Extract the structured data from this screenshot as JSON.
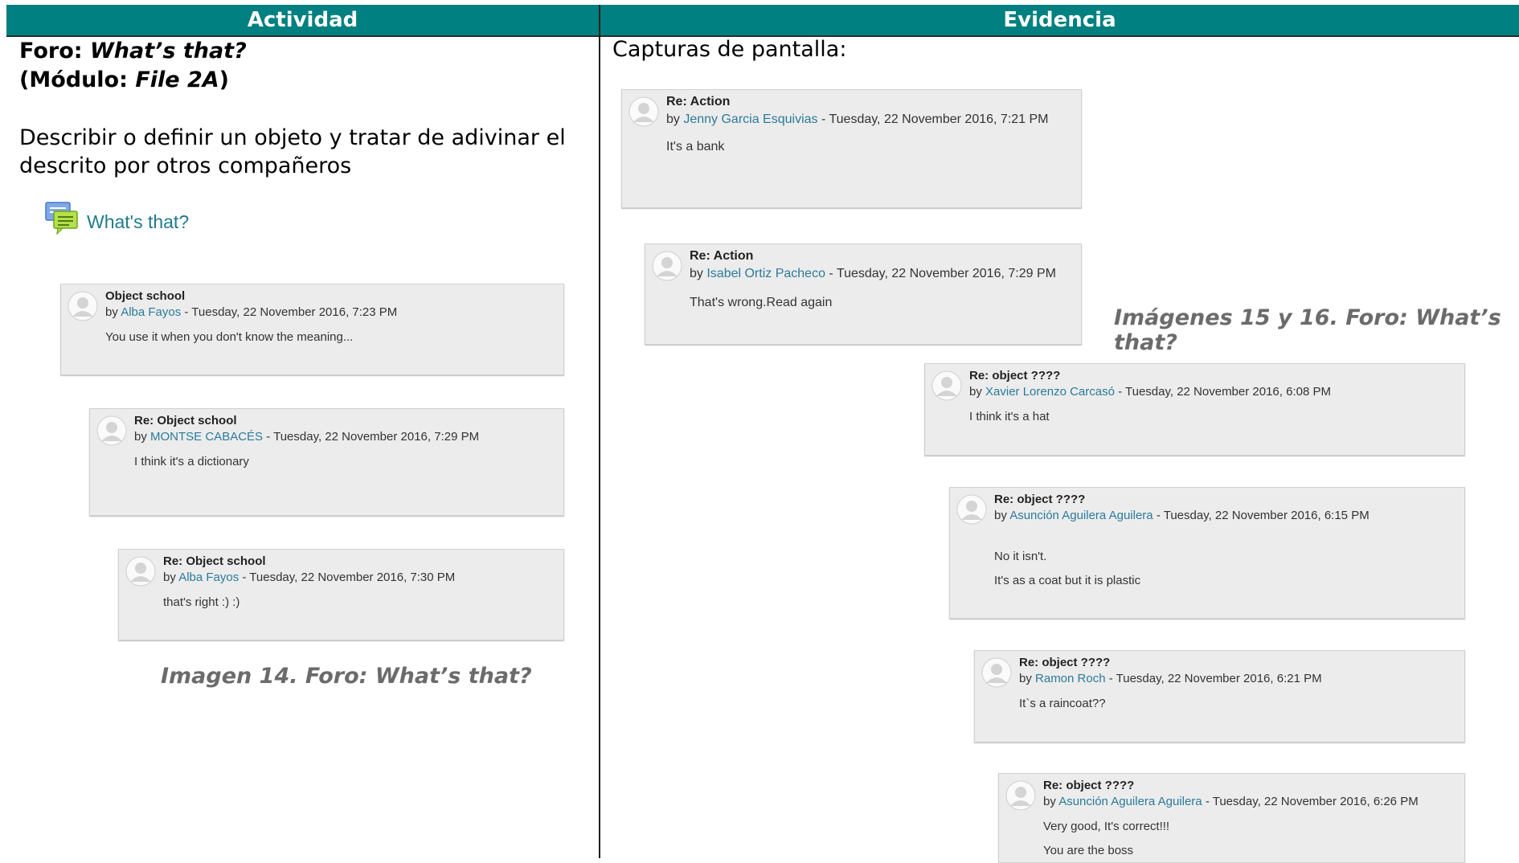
{
  "headers": {
    "left": "Actividad",
    "right": "Evidencia"
  },
  "activity": {
    "title_prefix": "Foro: ",
    "title_italic": "What’s that?",
    "module_open": "(Módulo: ",
    "module_italic": "File 2A",
    "module_close": ")",
    "description": "Describir o definir un objeto y tratar de adivinar el descrito por otros compañeros",
    "forum_link": "What's that?",
    "forum_icon": "chat-bubbles-icon"
  },
  "evidence": {
    "label": "Capturas de pantalla:"
  },
  "captions": {
    "left": "Imagen 14. Foro: What’s that?",
    "right": "Imágenes 15 y 16. Foro: What’s that?"
  },
  "posts": [
    {
      "subject": "Object school",
      "by": "by ",
      "author": "Alba Fayos",
      "date": " - Tuesday, 22 November 2016, 7:23 PM",
      "lines": [
        "You use it when you don't know the meaning..."
      ]
    },
    {
      "subject": "Re: Object school",
      "by": "by ",
      "author": "MONTSE CABACÉS",
      "date": " - Tuesday, 22 November 2016, 7:29 PM",
      "lines": [
        "I think it's a dictionary"
      ]
    },
    {
      "subject": "Re: Object school",
      "by": "by ",
      "author": "Alba Fayos",
      "date": " - Tuesday, 22 November 2016, 7:30 PM",
      "lines": [
        "that's right :) :)"
      ]
    },
    {
      "subject": "Re: Action",
      "by": "by ",
      "author": "Jenny Garcia Esquivias",
      "date": " - Tuesday, 22 November 2016, 7:21 PM",
      "lines": [
        "It's a bank"
      ]
    },
    {
      "subject": "Re: Action",
      "by": "by ",
      "author": "Isabel Ortiz Pacheco",
      "date": " - Tuesday, 22 November 2016, 7:29 PM",
      "lines": [
        "That's wrong.Read again"
      ]
    },
    {
      "subject": "Re: object ????",
      "by": "by ",
      "author": "Xavier Lorenzo Carcasó",
      "date": " - Tuesday, 22 November 2016, 6:08 PM",
      "lines": [
        "I think it's a hat"
      ]
    },
    {
      "subject": "Re: object ????",
      "by": "by ",
      "author": "Asunción Aguilera Aguilera",
      "date": " - Tuesday, 22 November 2016, 6:15 PM",
      "lines": [
        "No it isn't.",
        "It's as a coat but it is plastic"
      ]
    },
    {
      "subject": "Re: object ????",
      "by": "by ",
      "author": "Ramon Roch",
      "date": " - Tuesday, 22 November 2016, 6:21 PM",
      "lines": [
        "It`s a raincoat??"
      ]
    },
    {
      "subject": "Re: object ????",
      "by": "by ",
      "author": "Asunción Aguilera Aguilera",
      "date": " - Tuesday, 22 November 2016, 6:26 PM",
      "lines": [
        "Very good, It's correct!!!",
        "You are the boss"
      ]
    }
  ]
}
